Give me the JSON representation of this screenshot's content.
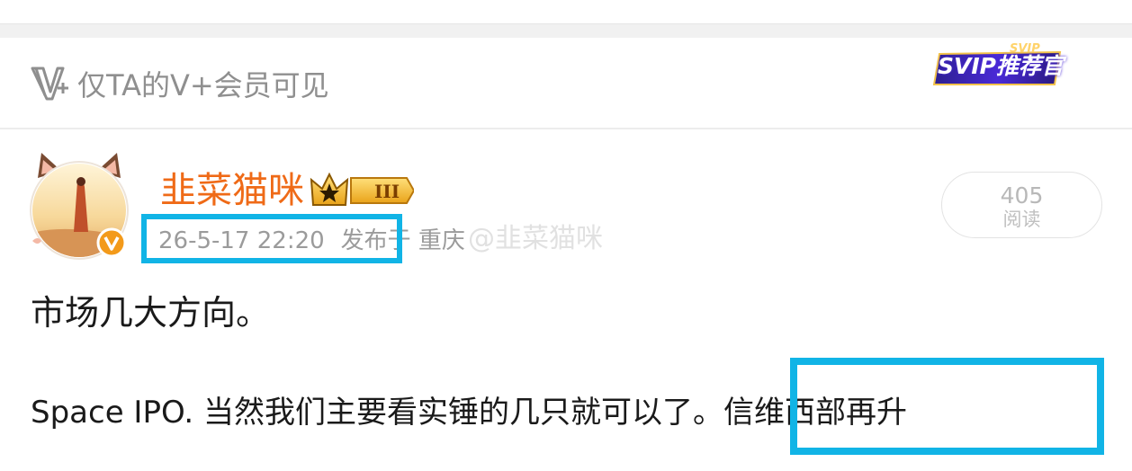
{
  "vip_notice": {
    "icon": "v-plus-icon",
    "text": "仅TA的V+会员可见",
    "badge_text": "SVIP推荐官",
    "badge_tag": "SVIP"
  },
  "author": {
    "name": "韭菜猫咪",
    "avatar": "avatar-cat-ears",
    "verified_icon": "verified-v-icon",
    "level_icon": "crown-level-icon",
    "level": "III"
  },
  "post_meta": {
    "time": "26-5-17 22:20",
    "location": "发布于 重庆",
    "watermark": "@韭菜猫咪"
  },
  "read_stats": {
    "count": "405",
    "label": "阅读"
  },
  "content": {
    "line1": "市场几大方向。",
    "line2": "Space IPO. 当然我们主要看实锤的几只就可以了。信维西部再升"
  },
  "colors": {
    "username": "#ef6a17",
    "highlight": "#11b4e6",
    "muted_text": "#9b9b9b"
  }
}
